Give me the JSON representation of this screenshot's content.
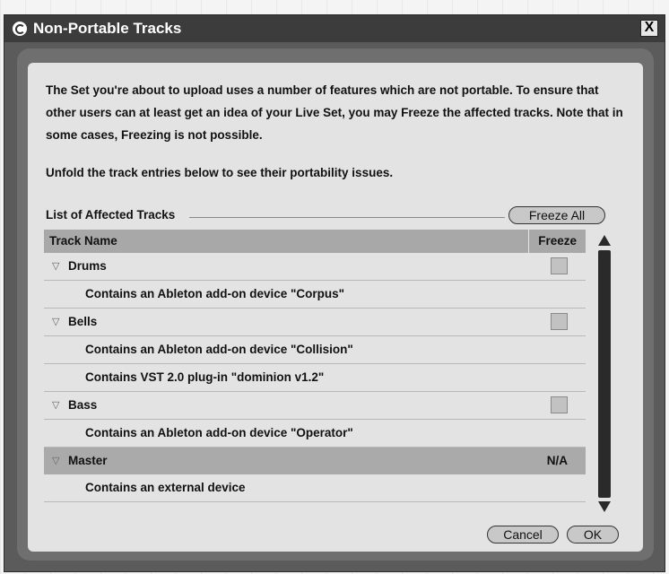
{
  "window": {
    "title": "Non-Portable Tracks",
    "close_glyph": "X"
  },
  "intro": "The Set you're about to upload uses a number of features which are not portable. To ensure that other users can at least get an idea of your Live Set, you may Freeze the affected tracks. Note that in some cases, Freezing is not possible.",
  "unfold_hint": "Unfold the track entries below to see their portability issues.",
  "list": {
    "label": "List of Affected Tracks",
    "freeze_all_label": "Freeze All",
    "columns": {
      "name": "Track Name",
      "freeze": "Freeze"
    },
    "rows": [
      {
        "kind": "track",
        "name": "Drums",
        "freeze": "checkbox",
        "checked": false
      },
      {
        "kind": "issue",
        "text": "Contains an Ableton add-on device \"Corpus\""
      },
      {
        "kind": "track",
        "name": "Bells",
        "freeze": "checkbox",
        "checked": false
      },
      {
        "kind": "issue",
        "text": "Contains an Ableton add-on device \"Collision\""
      },
      {
        "kind": "issue",
        "text": "Contains VST 2.0 plug-in \"dominion v1.2\""
      },
      {
        "kind": "track",
        "name": "Bass",
        "freeze": "checkbox",
        "checked": false
      },
      {
        "kind": "issue",
        "text": "Contains an Ableton add-on device \"Operator\""
      },
      {
        "kind": "track",
        "name": "Master",
        "freeze": "N/A",
        "selected": true
      },
      {
        "kind": "issue",
        "text": "Contains an external device"
      }
    ]
  },
  "buttons": {
    "cancel": "Cancel",
    "ok": "OK"
  },
  "icons": {
    "title": "live-logo-icon",
    "expand": "triangle-down-icon",
    "scroll_up": "scroll-up-arrow-icon",
    "scroll_down": "scroll-down-arrow-icon"
  },
  "colors": {
    "titlebar": "#3c3c3c",
    "panel": "#e3e3e3",
    "header": "#a8a8a8",
    "selected_row": "#aaaaaa"
  }
}
